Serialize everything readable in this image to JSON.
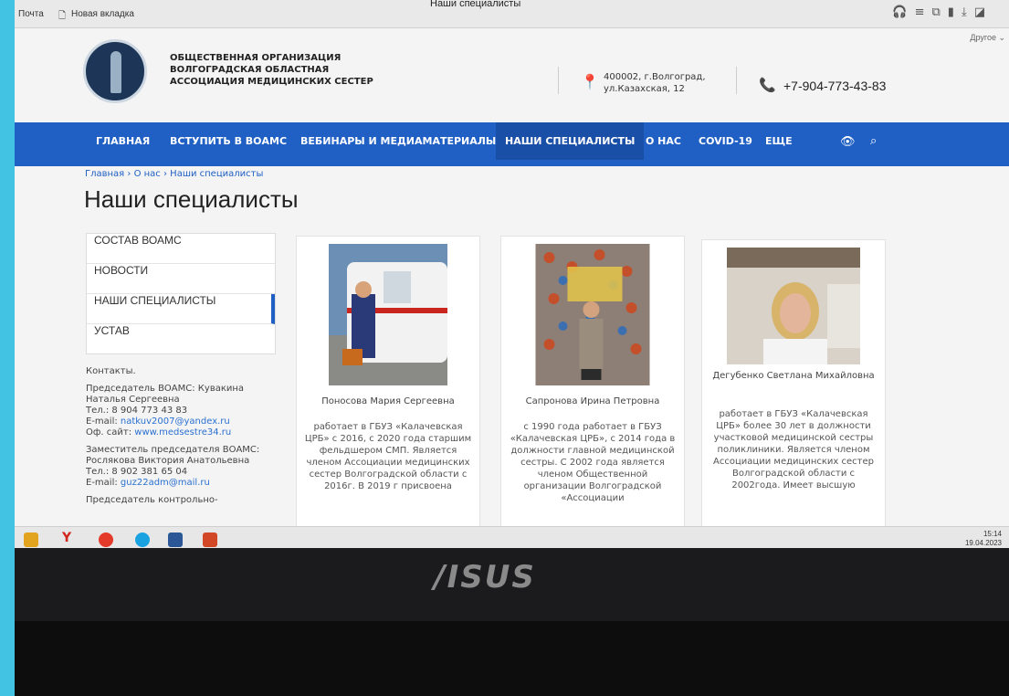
{
  "browser": {
    "tabs": [
      "Почта",
      "Новая вкладка"
    ],
    "page_title": "Наши специалисты",
    "other_label": "Другое ⌄",
    "icons": [
      "headphones-icon",
      "reader-icon",
      "extensions-icon",
      "bookmark-icon",
      "downloads-icon",
      "profile-icon"
    ]
  },
  "header": {
    "org_name": "Общественная организация Волгоградская областная ассоциация медицинских сестер",
    "address": "400002, г.Волгоград, ул.Казахская, 12",
    "phone": "+7-904-773-43-83",
    "colors": {
      "brand_blue": "#2060c4",
      "nav_active": "#1a4fa8"
    }
  },
  "nav": {
    "items": [
      "Главная",
      "Вступить в ВОАМС",
      "Вебинары и медиаматериалы",
      "Наши специалисты",
      "О нас",
      "COVID-19",
      "Еще"
    ],
    "active_index": 3,
    "icons": [
      "eye-icon",
      "search-icon"
    ]
  },
  "breadcrumb": [
    "Главная",
    "О нас",
    "Наши специалисты"
  ],
  "page": {
    "title": "Наши специалисты"
  },
  "sidebar": {
    "items": [
      "Состав ВОАМС",
      "Новости",
      "Наши специалисты",
      "Устав"
    ],
    "active_index": 2
  },
  "contacts": {
    "heading": "Контакты.",
    "chair_label": "Председатель ВОАМС: Кувакина Наталья Сергеевна",
    "chair_phone": "Тел.: 8 904 773 43 83",
    "chair_email_label": "E-mail: ",
    "chair_email": "natkuv2007@yandex.ru",
    "site_label": "Оф. сайт: ",
    "site": "www.medsestre34.ru",
    "deputy_label": "Заместитель председателя ВОАМС: Рослякова Виктория Анатольевна",
    "deputy_phone": "Тел.: 8 902 381 65 04",
    "deputy_email_label": "E-mail: ",
    "deputy_email": "guz22adm@mail.ru",
    "control_label": "Председатель контрольно-"
  },
  "specialists": [
    {
      "name": "Поносова Мария Сергеевна",
      "desc": "работает в ГБУЗ «Калачевская ЦРБ» с 2016, с 2020 года старшим фельдшером СМП. Является членом Ассоциации медицинских сестер Волгоградской области с 2016г. В 2019 г присвоена"
    },
    {
      "name": "Сапронова Ирина Петровна",
      "desc": "с 1990 года работает в ГБУЗ «Калачевская ЦРБ», с 2014 года в должности главной медицинской сестры. С 2002 года является членом Общественной организации Волгоградской «Ассоциации"
    },
    {
      "name": "Дегубенко Светлана Михайловна",
      "desc": "работает в ГБУЗ «Калачевская ЦРБ» более 30 лет в должности участковой медицинской сестры поликлиники. Является членом Ассоциации медицинских сестер Волгоградской области с 2002года. Имеет высшую"
    }
  ],
  "taskbar": {
    "apps": [
      "explorer-icon",
      "yandex-browser-icon",
      "yandex-icon",
      "skype-icon",
      "word-icon",
      "powerpoint-icon"
    ],
    "time": "15:14",
    "date": "19.04.2023"
  },
  "laptop": {
    "brand": "/ISUS"
  }
}
